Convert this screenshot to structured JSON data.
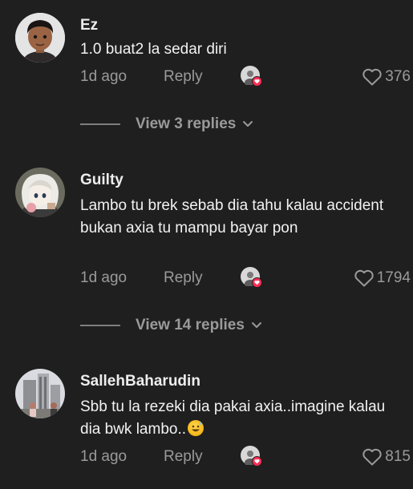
{
  "comments": [
    {
      "username": "Ez",
      "text": "1.0 buat2 la sedar diri",
      "time": "1d ago",
      "reply_label": "Reply",
      "likes": "376",
      "view_replies": "View 3 replies"
    },
    {
      "username": "Guilty",
      "text": "Lambo tu brek sebab dia tahu kalau accident bukan axia tu mampu bayar pon",
      "time": "1d ago",
      "reply_label": "Reply",
      "likes": "1794",
      "view_replies": "View 14 replies"
    },
    {
      "username": "SallehBaharudin",
      "text": "Sbb tu la rezeki dia pakai axia..imagine kalau dia bwk lambo..",
      "emoji": "sweat-smile-emoji",
      "time": "1d ago",
      "reply_label": "Reply",
      "likes": "815"
    }
  ],
  "colors": {
    "background": "#1f1f1f",
    "primary_text": "#f2f2f2",
    "secondary_text": "#9a9a9a",
    "heart_badge": "#fe2c55"
  },
  "icons": [
    "heart-outline-icon",
    "chevron-down-icon",
    "creator-liked-avatar-icon"
  ]
}
